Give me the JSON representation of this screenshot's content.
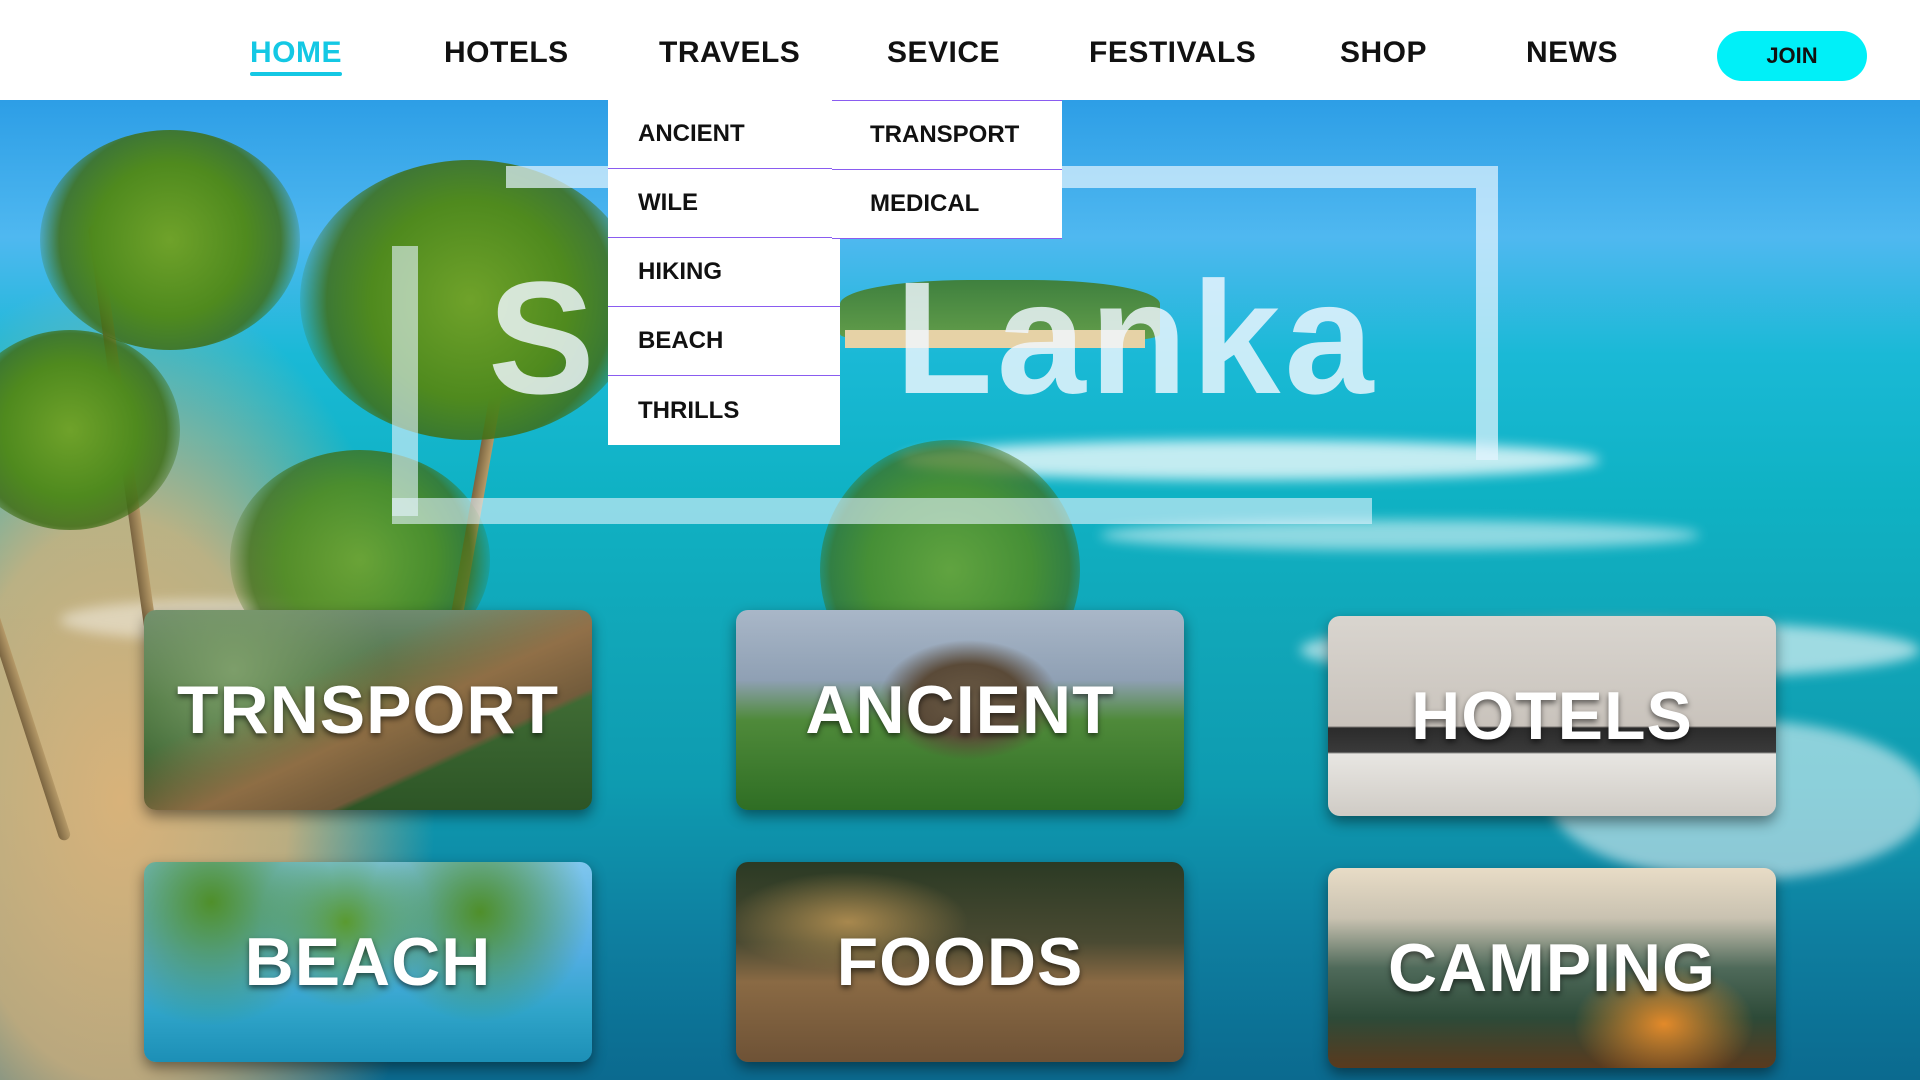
{
  "nav": {
    "items": [
      {
        "label": "HOME",
        "active": true
      },
      {
        "label": "HOTELS",
        "active": false
      },
      {
        "label": "TRAVELS",
        "active": false
      },
      {
        "label": "SEVICE",
        "active": false
      },
      {
        "label": "FESTIVALS",
        "active": false
      },
      {
        "label": "SHOP",
        "active": false
      },
      {
        "label": "NEWS",
        "active": false
      }
    ],
    "join_label": "JOIN"
  },
  "dropdown": {
    "left_items": [
      "ANCIENT",
      "WILE",
      "HIKING",
      "BEACH",
      "THRILLS"
    ],
    "right_items": [
      "TRANSPORT",
      "MEDICAL"
    ]
  },
  "hero": {
    "logo_part1": "S:",
    "logo_part2": "Lanka"
  },
  "cards": [
    {
      "label": "TRNSPORT"
    },
    {
      "label": "ANCIENT"
    },
    {
      "label": "HOTELS"
    },
    {
      "label": "BEACH"
    },
    {
      "label": "FOODS"
    },
    {
      "label": "CAMPING"
    }
  ],
  "colors": {
    "accent": "#14c8e4",
    "join_button": "#00f0f8",
    "dropdown_divider": "#8a5cf0"
  }
}
